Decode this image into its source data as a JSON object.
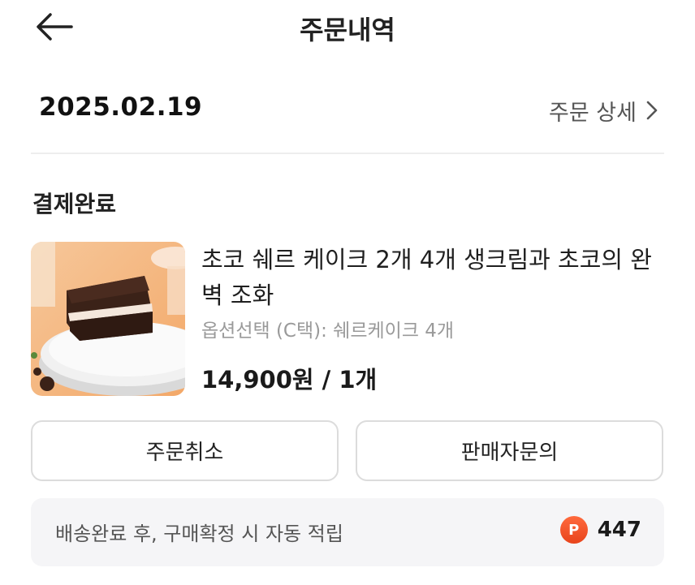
{
  "header": {
    "title": "주문내역",
    "back_icon": "arrow-left-icon"
  },
  "order": {
    "date": "2025.02.19",
    "detail_label": "주문 상세",
    "detail_icon": "chevron-right-icon",
    "status": "결제완료"
  },
  "product": {
    "name": "초코 쉐르 케이크 2개 4개 생크림과 초코의 완벽 조화",
    "option": "옵션선택 (C택): 쉐르케이크 4개",
    "price": "14,900원 / 1개",
    "image": "chocolate-cake-photo"
  },
  "actions": {
    "cancel_label": "주문취소",
    "inquiry_label": "판매자문의"
  },
  "points": {
    "text": "배송완료 후, 구매확정 시 자동 적립",
    "badge": "P",
    "value": "447",
    "badge_color": "#ee4e22"
  }
}
